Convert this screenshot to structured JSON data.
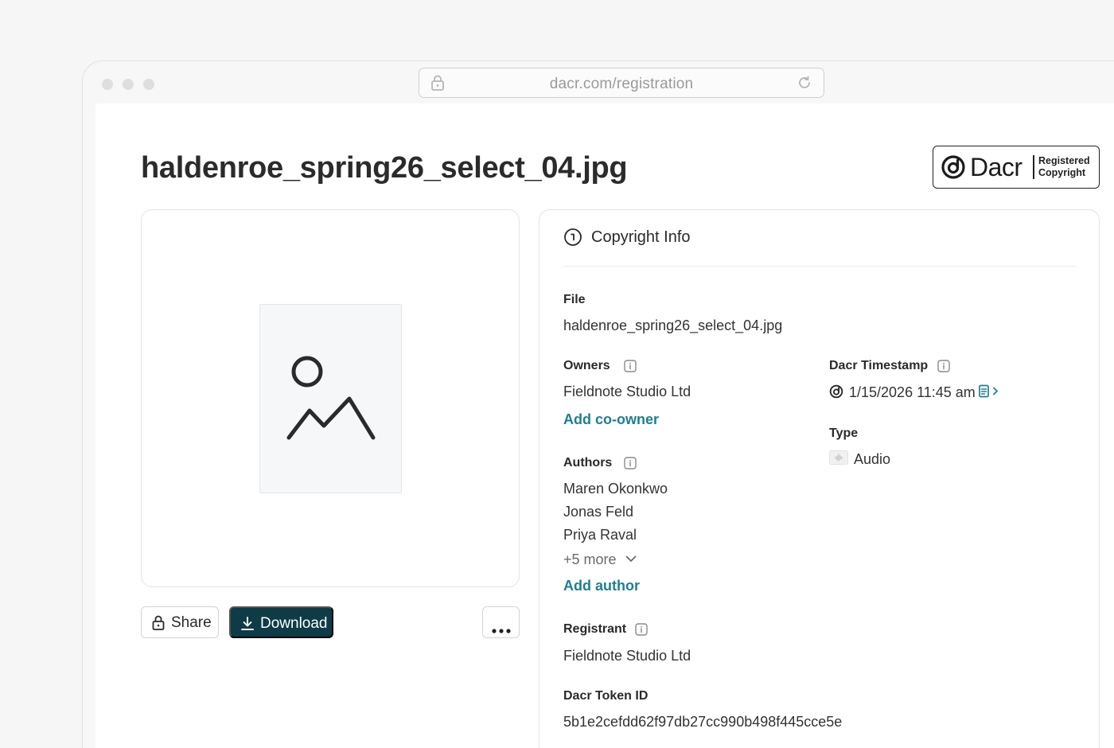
{
  "browser": {
    "url": "dacr.com/registration"
  },
  "page": {
    "title": "haldenroe_spring26_select_04.jpg"
  },
  "badge": {
    "brand": "Dacr",
    "line1": "Registered",
    "line2": "Copyright"
  },
  "actions": {
    "share_label": "Share",
    "download_label": "Download"
  },
  "info": {
    "heading": "Copyright Info",
    "file_label": "File",
    "file_value": "haldenroe_spring26_select_04.jpg",
    "owners_label": "Owners",
    "owners": [
      "Fieldnote Studio Ltd"
    ],
    "add_coowner": "Add co-owner",
    "authors_label": "Authors",
    "authors": [
      "Maren Okonkwo",
      "Jonas Feld",
      "Priya Raval"
    ],
    "authors_more": "+5 more",
    "add_author": "Add author",
    "registrant_label": "Registrant",
    "registrant_value": "Fieldnote Studio Ltd",
    "token_label": "Dacr Token ID",
    "token_value": "5b1e2cefdd62f97db27cc990b498f445cce5e",
    "timestamp_label": "Dacr Timestamp",
    "timestamp_value": "1/15/2026 11:45 am",
    "type_label": "Type",
    "type_value": "Audio"
  },
  "colors": {
    "accent": "#1e7f8e",
    "primary_button": "#0d3c46"
  }
}
